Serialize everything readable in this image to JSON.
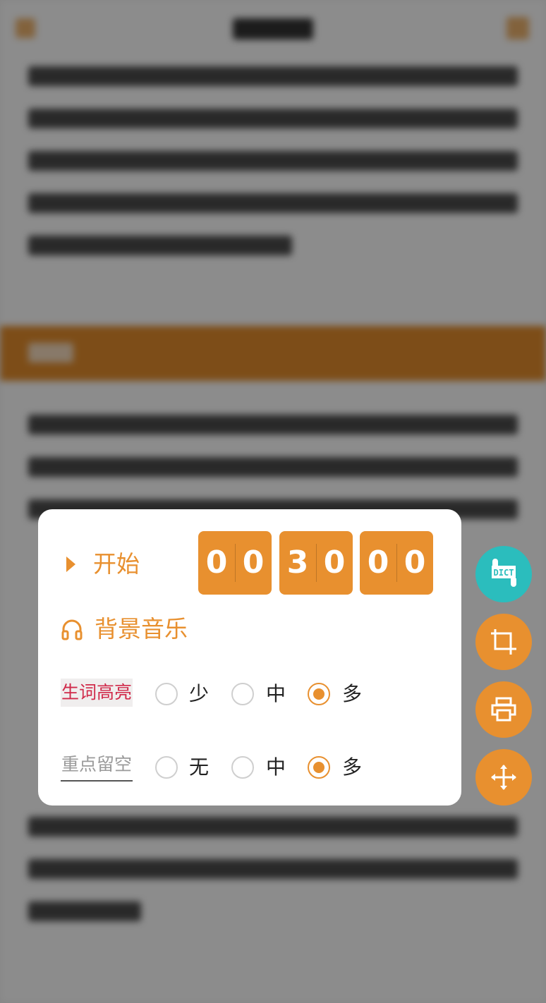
{
  "dialog": {
    "start_label": "开始",
    "timer": {
      "digits": [
        "0",
        "0",
        "3",
        "0",
        "0",
        "0"
      ]
    },
    "music_label": "背景音乐",
    "highlight_row": {
      "label": "生词高亮",
      "options": [
        {
          "label": "少",
          "checked": false
        },
        {
          "label": "中",
          "checked": false
        },
        {
          "label": "多",
          "checked": true
        }
      ]
    },
    "keypoint_row": {
      "label": "重点留空",
      "options": [
        {
          "label": "无",
          "checked": false
        },
        {
          "label": "中",
          "checked": false
        },
        {
          "label": "多",
          "checked": true
        }
      ]
    }
  },
  "fabs": {
    "dict_label": "DICT"
  },
  "colors": {
    "accent": "#e8902f",
    "dict": "#2bbdbd",
    "highlight_label": "#d02a4a"
  },
  "icons": [
    "play-icon",
    "headphones-icon",
    "dict-icon",
    "crop-icon",
    "print-icon",
    "move-icon"
  ]
}
